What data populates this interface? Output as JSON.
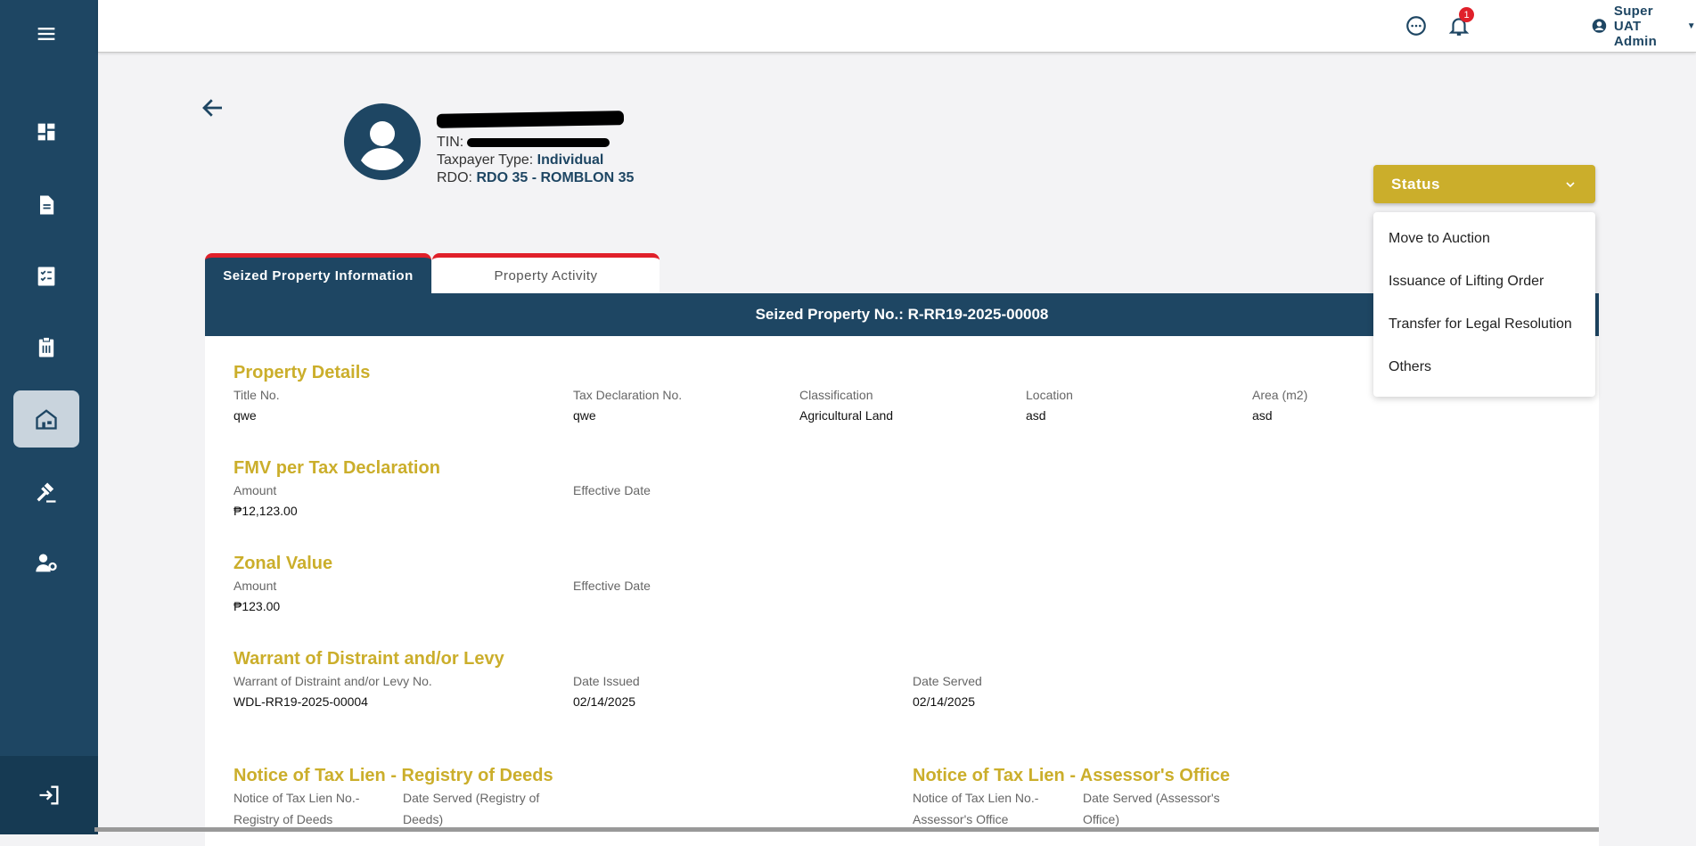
{
  "header": {
    "user_name": "Super UAT Admin",
    "notification_count": "1"
  },
  "taxpayer": {
    "tin_label": "TIN:",
    "type_label": "Taxpayer Type:",
    "type_value": "Individual",
    "rdo_label": "RDO:",
    "rdo_value": "RDO 35 - ROMBLON 35"
  },
  "status": {
    "label": "Status",
    "options": [
      "Move to Auction",
      "Issuance of Lifting Order",
      "Transfer for Legal Resolution",
      "Others"
    ]
  },
  "tabs": [
    {
      "label": "Seized Property Information",
      "active": true
    },
    {
      "label": "Property Activity",
      "active": false
    }
  ],
  "card": {
    "title": "Seized Property No.: R-RR19-2025-00008"
  },
  "property_details": {
    "title": "Property Details",
    "title_no_label": "Title No.",
    "title_no": "qwe",
    "tax_decl_label": "Tax Declaration No.",
    "tax_decl": "qwe",
    "classification_label": "Classification",
    "classification": "Agricultural Land",
    "location_label": "Location",
    "location": "asd",
    "area_label": "Area (m2)",
    "area": "asd"
  },
  "fmv": {
    "title": "FMV per Tax Declaration",
    "amount_label": "Amount",
    "amount": "₱12,123.00",
    "effective_label": "Effective Date"
  },
  "zonal": {
    "title": "Zonal Value",
    "amount_label": "Amount",
    "amount": "₱123.00",
    "effective_label": "Effective Date"
  },
  "warrant": {
    "title": "Warrant of Distraint and/or Levy",
    "no_label": "Warrant of Distraint and/or Levy No.",
    "no": "WDL-RR19-2025-00004",
    "issued_label": "Date Issued",
    "issued": "02/14/2025",
    "served_label": "Date Served",
    "served": "02/14/2025"
  },
  "lien_rod": {
    "title": "Notice of Tax Lien - Registry of Deeds",
    "no_label": "Notice of Tax Lien No.- Registry of Deeds",
    "served_label": "Date Served (Registry of Deeds)"
  },
  "lien_assessor": {
    "title": "Notice of Tax Lien - Assessor's Office",
    "no_label": "Notice of Tax Lien No.- Assessor's Office",
    "served_label": "Date Served (Assessor's Office)"
  },
  "colors": {
    "primary": "#1e4663",
    "accent": "#cbae2b",
    "tab_border": "#e0202a"
  }
}
